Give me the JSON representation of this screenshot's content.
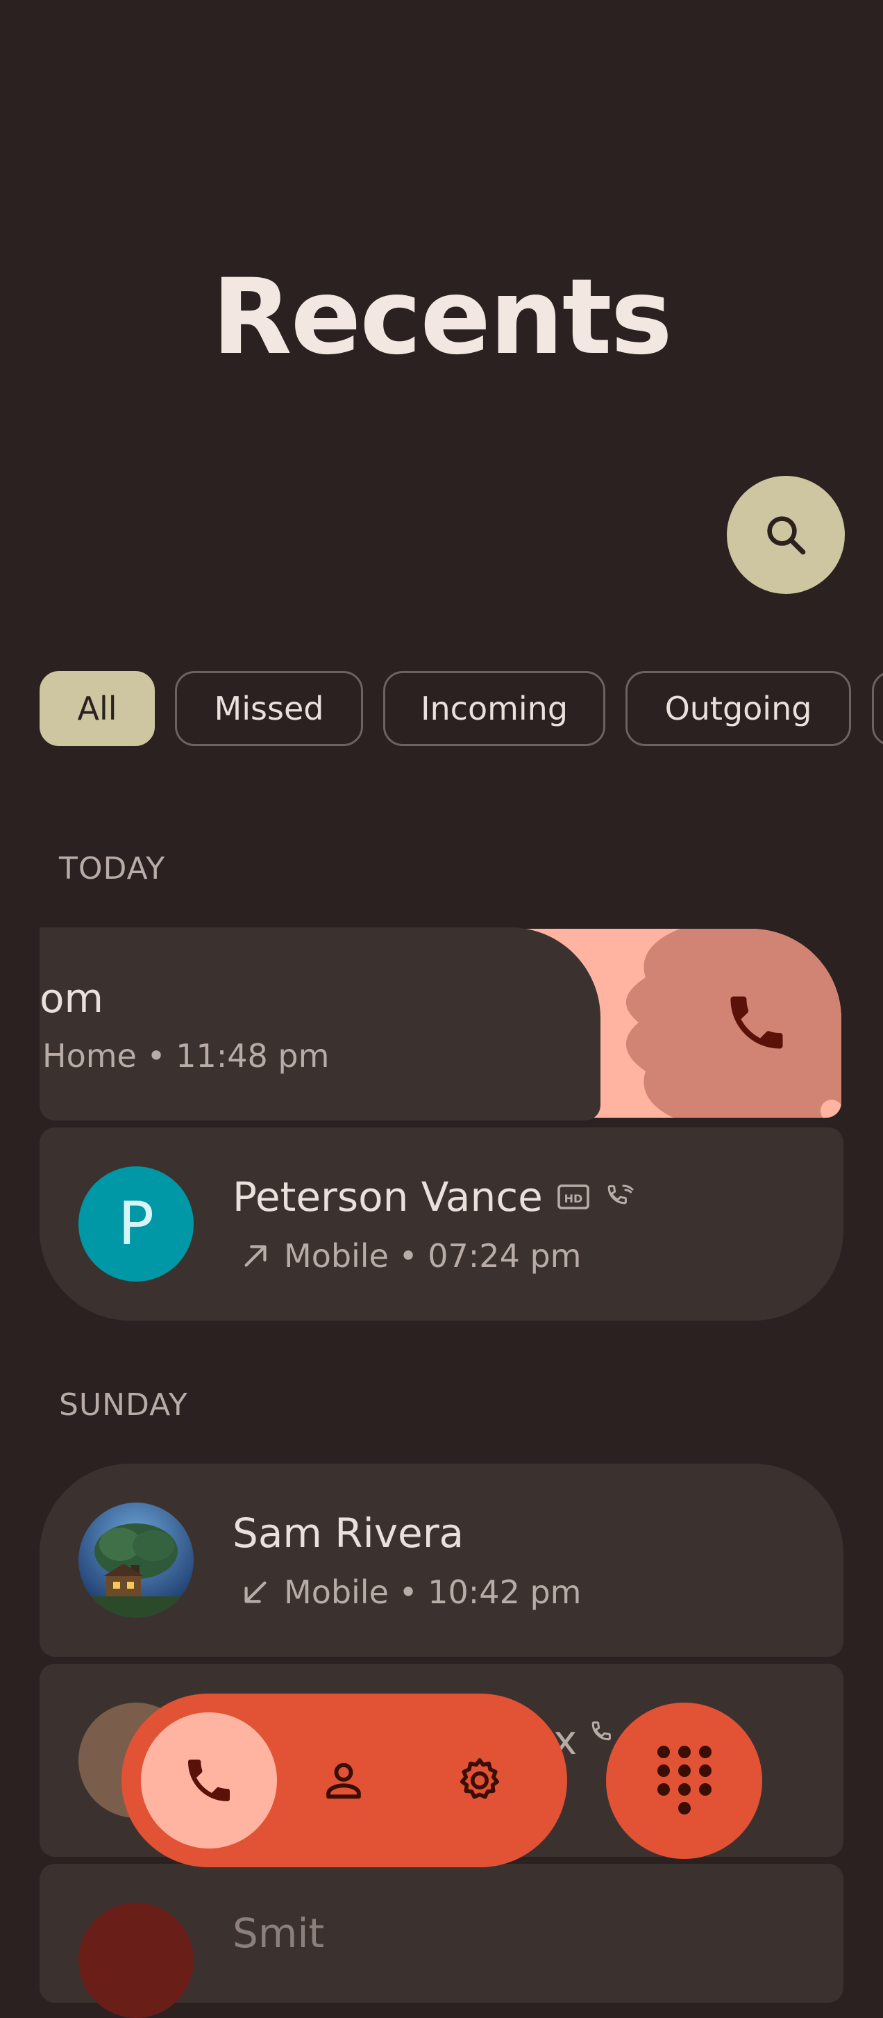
{
  "header": {
    "title": "Recents"
  },
  "search": {
    "icon": "search-icon"
  },
  "filters": [
    {
      "label": "All",
      "active": true
    },
    {
      "label": "Missed",
      "active": false
    },
    {
      "label": "Incoming",
      "active": false
    },
    {
      "label": "Outgoing",
      "active": false
    }
  ],
  "sections": {
    "today": "TODAY",
    "sunday": "SUNDAY"
  },
  "calls": [
    {
      "name": "om",
      "detail": "Home • 11:48 pm",
      "swiped": true
    },
    {
      "name": "Peterson Vance",
      "initial": "P",
      "detail": "Mobile • 07:24 pm",
      "direction": "outgoing",
      "badges": [
        "hd-icon",
        "wifi-call-icon"
      ]
    },
    {
      "name": "Sam Rivera",
      "detail": "Mobile • 10:42 pm",
      "direction": "incoming"
    },
    {
      "name": "x",
      "partial": true
    },
    {
      "name": "Smit",
      "partial": true
    }
  ],
  "nav": {
    "items": [
      "phone-icon",
      "contacts-icon",
      "settings-icon"
    ],
    "active": "phone-icon",
    "dialpad": "dialpad-icon"
  },
  "colors": {
    "background": "#2a2120",
    "card": "#3b3230",
    "accent": "#e25235",
    "chip_active": "#cdc6a1",
    "swipe_bg": "#ffb4a1",
    "avatar_teal": "#0097a7"
  }
}
